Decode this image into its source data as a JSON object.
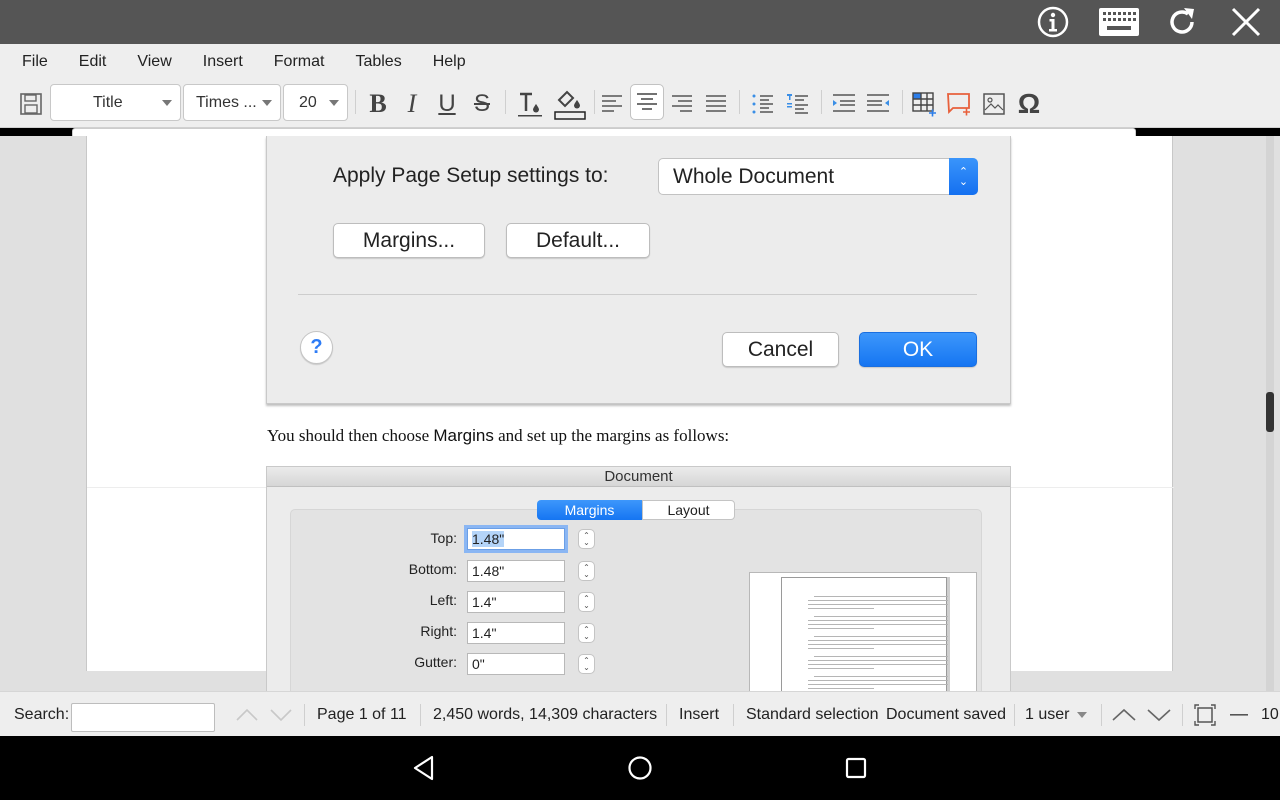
{
  "topbar": {
    "icons": [
      "info-icon",
      "keyboard-icon",
      "refresh-icon",
      "close-icon"
    ]
  },
  "menubar": {
    "items": [
      "File",
      "Edit",
      "View",
      "Insert",
      "Format",
      "Tables",
      "Help"
    ]
  },
  "toolbar": {
    "style_value": "Title",
    "font_value": "Times ...",
    "size_value": "20",
    "buttons": [
      "save",
      "bold",
      "italic",
      "underline",
      "strikethrough",
      "text-color",
      "highlight-color",
      "align-left",
      "align-center",
      "align-right",
      "justify",
      "bullet-list",
      "numbered-list",
      "decrease-indent",
      "increase-indent",
      "insert-table",
      "insert-comment",
      "insert-image",
      "insert-special-character"
    ],
    "active_alignment": "center",
    "accent_color": "#e8603c"
  },
  "document": {
    "page_setup_image": {
      "apply_label": "Apply Page Setup settings to:",
      "apply_value": "Whole Document",
      "margins_button": "Margins...",
      "default_button": "Default...",
      "help_button": "?",
      "cancel_button": "Cancel",
      "ok_button": "OK"
    },
    "paragraph": {
      "before": "You should then choose ",
      "highlight": "Margins",
      "after": " and set up the margins as follows:"
    },
    "margins_image": {
      "title": "Document",
      "tabs": [
        "Margins",
        "Layout"
      ],
      "active_tab": "Margins",
      "fields": [
        {
          "label": "Top:",
          "value": "1.48\""
        },
        {
          "label": "Bottom:",
          "value": "1.48\""
        },
        {
          "label": "Left:",
          "value": "1.4\""
        },
        {
          "label": "Right:",
          "value": "1.4\""
        },
        {
          "label": "Gutter:",
          "value": "0\""
        }
      ]
    }
  },
  "statusbar": {
    "search_label": "Search:",
    "search_value": "",
    "page_info": "Page 1 of 11",
    "word_count": "2,450 words, 14,309 characters",
    "mode": "Insert",
    "selection_mode": "Standard selection",
    "save_status": "Document saved",
    "users": "1 user",
    "zoom": "10"
  },
  "android_nav": [
    "back",
    "home",
    "recents"
  ]
}
